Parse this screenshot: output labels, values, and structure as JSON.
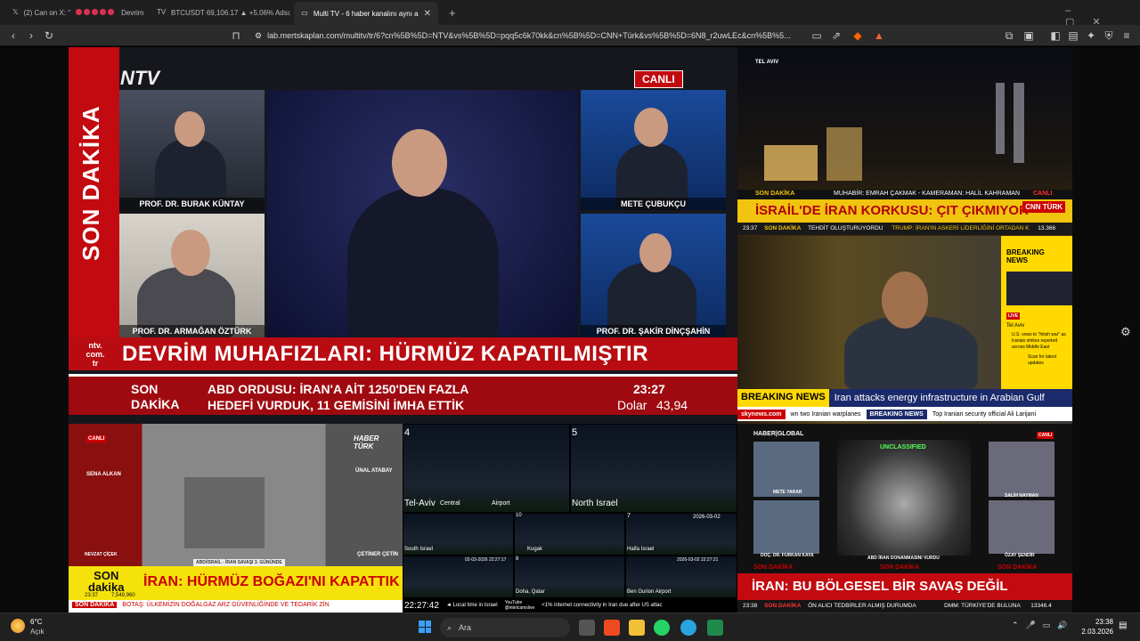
{
  "tabs": [
    {
      "label": "(2) Can on X: \"",
      "suffix": "Devrim",
      "active": false
    },
    {
      "label": "BTCUSDT 69,106.17 ▲ +5.06% Adsız",
      "active": false
    },
    {
      "label": "Multi TV - 6 haber kanalını aynı a",
      "active": true
    }
  ],
  "new_tab": "+",
  "url": "lab.mertskaplan.com/multitv/tr/6?cn%5B%5D=NTV&vs%5B%5D=pqq5c6k70kk&cn%5B%5D=CNN+Türk&vs%5B%5D=6N8_r2uwLEc&cn%5B%5...",
  "ntv": {
    "brand": "NTV",
    "live": "CANLI",
    "side": "SON DAKİKA",
    "guests": [
      "PROF. DR. BURAK KÜNTAY",
      "PROF. DR. ARMAĞAN ÖZTÜRK",
      "METE ÇUBUKÇU",
      "PROF. DR. ŞAKİR DİNÇŞAHİN"
    ],
    "site": "ntv.\ncom.\ntr",
    "headline": "DEVRİM MUHAFIZLARI: HÜRMÜZ KAPATILMIŞTIR",
    "sd": "SON\nDAKİKA",
    "ticker1": "ABD ORDUSU: İRAN'A AİT 1250'DEN FAZLA",
    "ticker2": "HEDEFİ VURDUK, 11 GEMİSİNİ İMHA ETTİK",
    "time": "23:27",
    "usd_label": "Dolar",
    "usd": "43,94"
  },
  "cnn": {
    "loc": "TEL AVIV",
    "bar1_left": "SON DAKİKA",
    "bar1": "MUHABİR: EMRAH ÇAKMAK - KAMERAMAN: HALİL KAHRAMAN",
    "live": "CANLI",
    "headline": "İSRAİL'DE İRAN KORKUSU: ÇIT ÇIKMIYOR",
    "logo": "CNN TÜRK",
    "t_time": "23:37",
    "t_sd": "SON DAKİKA",
    "t1": "TEHDİT OLUŞTURUYORDU",
    "t2": "TRUMP: İRAN'IN ASKERİ LİDERLİĞİNİ ORTADAN K",
    "t3": "13.366"
  },
  "sky": {
    "side_title": "BREAKING NEWS",
    "side_live": "LIVE",
    "side_loc": "Tel Aviv",
    "side_txt": "U.S. vows to \"finish war\" as Iranian strikes reported across Middle East",
    "side_scan": "Scan for latest updates",
    "bn_label": "BREAKING NEWS",
    "bn_text": "Iran attacks energy infrastructure in Arabian Gulf",
    "logo": "skynews.com",
    "t1": "wn two Iranian warplanes",
    "t2": "BREAKING NEWS",
    "t3": "Top Iranian security official Ali Larijani"
  },
  "ht": {
    "live": "CANLI",
    "brand": "HABER TÜRK",
    "guests": [
      "SENA ALKAN",
      "ÜNAL ATABAY",
      "NEVZAT ÇİÇEK",
      "ÇETİNER ÇETİN"
    ],
    "sub": "ABD/İSRAİL - İRAN SAVAŞI 3. GÜNÜNDE",
    "sd": "SON\ndakika",
    "headline": "İRAN: HÜRMÜZ BOĞAZI'NI KAPATTIK",
    "time": "23:37",
    "count": "7,549,960",
    "t_sd": "SON DAKİKA",
    "t1": "BOTAŞ: ÜLKEMİZİN DOĞALGAZ ARZ GÜVENLİĞİNDE VE TEDARİK ZİN"
  },
  "cams": {
    "labels": [
      "4",
      "5",
      "Tel-Aviv",
      "Central",
      "Airport",
      "North Israel",
      "7",
      "South Israel",
      "10",
      "Kugak",
      "8",
      "Haifa Israel",
      "Doha, Qatar",
      "Ben Gurion Airport"
    ],
    "stamps": [
      "2026-03-02",
      "02-03-2026 22:27:17",
      "2026-03-02 22:27:21"
    ],
    "clock": "22:27:42",
    "local": "◄ Local time in Israel",
    "yt": "YouTube\n@intelcamslive",
    "foot": "<1% internet connectivity in Iran due after US attac"
  },
  "hg": {
    "brand": "HABER|GLOBAL",
    "live": "CANLI",
    "unclass": "UNCLASSIFIED",
    "guests": [
      "METE YARAR",
      "SALİH NAYMAN",
      "DOÇ. DR. FURKAN KAYA",
      "ÖZAY ŞENDİR"
    ],
    "caption": "ABD İRAN DONANMASINI VURDU",
    "sd": "SON DAKİKA",
    "headline": "İRAN: BU BÖLGESEL BİR SAVAŞ DEĞİL",
    "time": "23:38",
    "t_sd": "SON DAKİKA",
    "t1": "ÖN ALICI TEDBİRLER ALMIŞ DURUMDA",
    "t2": "DMM: TÜRKİYE'DE BULUNA",
    "t3": "13346.4"
  },
  "taskbar": {
    "temp": "6°C",
    "weather": "Açık",
    "search": "Ara",
    "time": "23:38",
    "date": "2.03.2026"
  }
}
